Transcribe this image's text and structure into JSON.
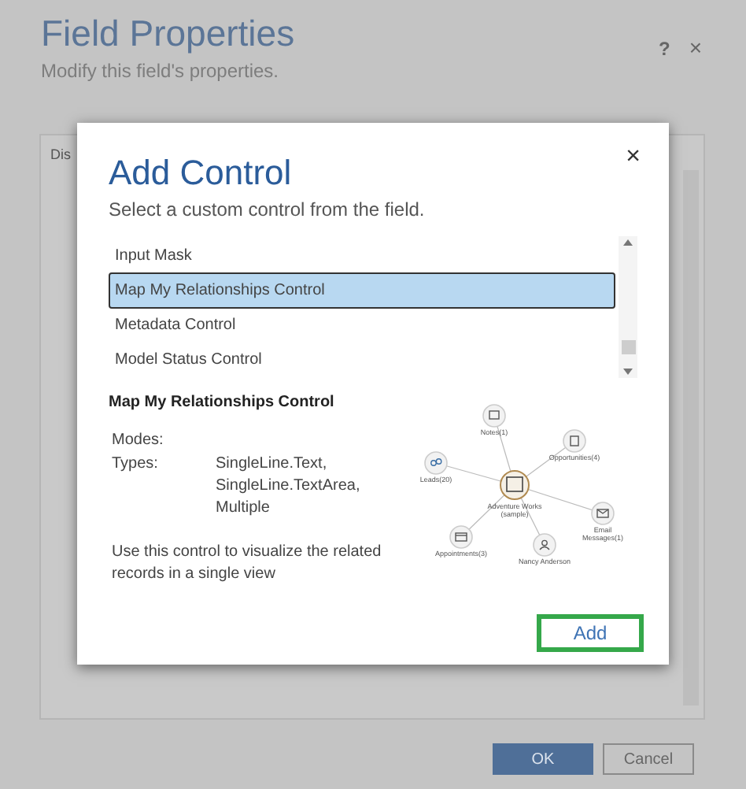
{
  "background_dialog": {
    "title": "Field Properties",
    "subtitle": "Modify this field's properties.",
    "help": "?",
    "close": "×",
    "tab": "Dis",
    "buttons": [
      {
        "label": "OK",
        "kind": "primary"
      },
      {
        "label": "Cancel",
        "kind": "secondary"
      }
    ]
  },
  "modal": {
    "title": "Add Control",
    "subtitle": "Select a custom control from the field.",
    "close": "×",
    "controls": [
      {
        "label": "Input Mask",
        "selected": false
      },
      {
        "label": "Map My Relationships Control",
        "selected": true
      },
      {
        "label": "Metadata Control",
        "selected": false
      },
      {
        "label": "Model Status Control",
        "selected": false
      }
    ],
    "details": {
      "heading": "Map My Relationships Control",
      "modes_label": "Modes:",
      "types_label": "Types:",
      "types": [
        "SingleLine.Text,",
        "SingleLine.TextArea,",
        "Multiple"
      ],
      "description": "Use this control to visualize the related records in a single view"
    },
    "preview": {
      "center": [
        "Adventure Works",
        "(sample)"
      ],
      "nodes": [
        {
          "label": [
            "Notes(1)"
          ],
          "kind": "note"
        },
        {
          "label": [
            "Opportunities(4)"
          ],
          "kind": "doc"
        },
        {
          "label": [
            "Leads(20)"
          ],
          "kind": "people"
        },
        {
          "label": [
            "Email",
            "Messages(1)"
          ],
          "kind": "mail"
        },
        {
          "label": [
            "Appointments(3)"
          ],
          "kind": "calendar"
        },
        {
          "label": [
            "Nancy Anderson"
          ],
          "kind": "person"
        }
      ]
    },
    "add_button": "Add"
  }
}
